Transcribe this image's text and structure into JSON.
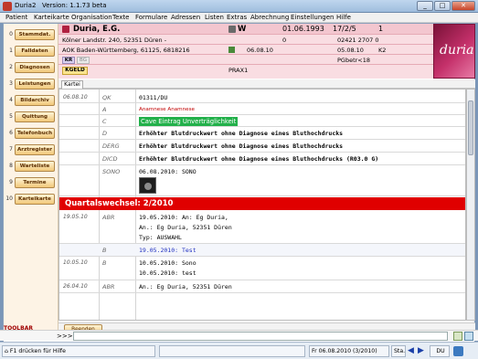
{
  "window": {
    "title": "Duria2",
    "version": "Version: 1.1.73 beta",
    "minimize": "_",
    "maximize": "□",
    "close": "✕"
  },
  "menu": [
    "Patient",
    "Karteikarte",
    "Organisation",
    "Texte",
    "Formulare",
    "Adressen",
    "Listen",
    "Extras",
    "Abrechnung",
    "Einstellungen",
    "Hilfe"
  ],
  "sidebar": [
    {
      "num": "0",
      "label": "Stammdat."
    },
    {
      "num": "1",
      "label": "Falldaten"
    },
    {
      "num": "2",
      "label": "Diagnosen"
    },
    {
      "num": "3",
      "label": "Leistungen"
    },
    {
      "num": "4",
      "label": "Bildarchiv"
    },
    {
      "num": "5",
      "label": "Quittung"
    },
    {
      "num": "6",
      "label": "Telefonbuch"
    },
    {
      "num": "7",
      "label": "Arztregister"
    },
    {
      "num": "8",
      "label": "Warteliste"
    },
    {
      "num": "9",
      "label": "Termine"
    },
    {
      "num": "10",
      "label": "Karteikarte"
    }
  ],
  "patient": {
    "name": "Duria, E.G.",
    "sex": "W",
    "dob": "01.06.1993",
    "code1": "17/2/5",
    "code2": "1",
    "address": "Kölner Landstr. 240, 52351 Düren -",
    "address_val": "0",
    "phone": "02421 2707 0",
    "insurance": "AOK Baden-Württemberg, 61125, 6818216",
    "card_date": "06.08.10",
    "date2": "05.08.10",
    "k2": "K2",
    "badge_kr": "KR",
    "badge_bg": "BG",
    "pgbetr": "PGbetr<18",
    "kgeld": "KGELD",
    "praxis": "PRAX1",
    "logo": "duria"
  },
  "tab": "Kartei 0",
  "records": [
    {
      "date": "06.08.10",
      "code": "QK",
      "text": "01311/DU",
      "style": "normal"
    },
    {
      "date": "",
      "code": "A",
      "text": "Anamnese Anamnese",
      "style": "red-small"
    },
    {
      "date": "",
      "code": "C",
      "text": "Cave Eintrag Unverträglichkeit",
      "style": "cave"
    },
    {
      "date": "",
      "code": "D",
      "text": "Erhöhter Blutdruckwert ohne Diagnose eines Bluthochdrucks",
      "style": "bold"
    },
    {
      "date": "",
      "code": "DERG",
      "text": "Erhöhter Blutdruckwert ohne Diagnose eines Bluthochdrucks",
      "style": "bold"
    },
    {
      "date": "",
      "code": "DICD",
      "text": "Erhöhter Blutdruckwert ohne Diagnose eines Bluthochdrucks (R03.0 G)",
      "style": "bold"
    },
    {
      "date": "",
      "code": "SONO",
      "text": "06.08.2010: SONO",
      "style": "normal"
    },
    {
      "date": "19.05.10",
      "code": "ABR",
      "text": "19.05.2010: An: Eg Duria,",
      "style": "normal"
    },
    {
      "date": "",
      "code": "",
      "text": "An.: Eg Duria, 52351 Düren",
      "style": "normal"
    },
    {
      "date": "",
      "code": "",
      "text": "Typ: AUSWAHL",
      "style": "normal"
    },
    {
      "date": "",
      "code": "B",
      "text": "19.05.2010: Test",
      "style": "blue"
    },
    {
      "date": "10.05.10",
      "code": "B",
      "text": "10.05.2010: Sono",
      "style": "normal"
    },
    {
      "date": "",
      "code": "",
      "text": "10.05.2010: test",
      "style": "normal"
    },
    {
      "date": "26.04.10",
      "code": "ABR",
      "text": "An.: Eg Duria, 52351 Düren",
      "style": "normal"
    }
  ],
  "quartal": "Quartalswechsel: 2/2010",
  "beenden": "Beenden",
  "toolbar_label": "TOOLBAR",
  "cmd_prompt": ">>>",
  "status": {
    "help": "F1 drücken für Hilfe",
    "date": "Fr  06.08.2010  (3/2010)",
    "sta": "Sta...",
    "user": "DU"
  },
  "colors": {
    "sidebar_btn": "#f1c879",
    "header_bg": "#f9dde2",
    "quartal_red": "#e00000",
    "cave_green": "#22b04a"
  }
}
